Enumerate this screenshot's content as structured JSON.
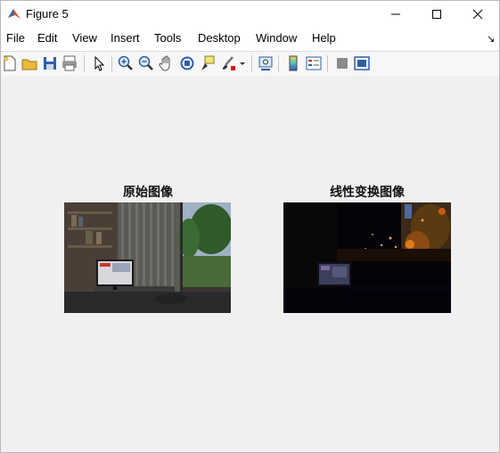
{
  "window": {
    "title": "Figure 5"
  },
  "menu": {
    "items": [
      {
        "label": "File"
      },
      {
        "label": "Edit"
      },
      {
        "label": "View"
      },
      {
        "label": "Insert"
      },
      {
        "label": "Tools"
      },
      {
        "label": "Desktop"
      },
      {
        "label": "Window"
      },
      {
        "label": "Help"
      }
    ],
    "overflow_arrow": "↘"
  },
  "toolbar": {
    "icons": [
      "new-figure-icon",
      "open-file-icon",
      "save-icon",
      "print-icon",
      "select-pointer-icon",
      "zoom-in-icon",
      "zoom-out-icon",
      "pan-hand-icon",
      "rotate-3d-icon",
      "data-cursor-icon",
      "brush-icon",
      "link-plot-icon",
      "colorbar-icon",
      "legend-icon",
      "hide-plot-tools-icon",
      "show-plot-tools-icon"
    ]
  },
  "axes": [
    {
      "title": "原始图像"
    },
    {
      "title": "线性变换图像"
    }
  ]
}
